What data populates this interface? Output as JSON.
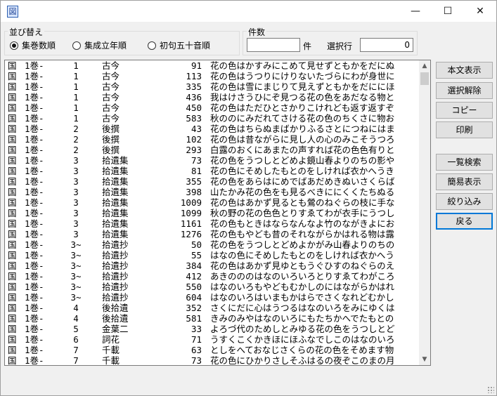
{
  "window": {
    "app_icon_glyph": "図",
    "controls": {
      "minimize": "—",
      "maximize": "☐",
      "close": "✕"
    }
  },
  "sort": {
    "label": "並び替え",
    "options": [
      {
        "label": "集巻数順",
        "selected": true
      },
      {
        "label": "集成立年順",
        "selected": false
      },
      {
        "label": "初句五十音順",
        "selected": false
      }
    ]
  },
  "count": {
    "label": "件数",
    "count_value": "",
    "count_unit": "件",
    "selected_label": "選択行",
    "selected_value": "0"
  },
  "list": {
    "rows": [
      {
        "kuni": "国",
        "kan": "1巻-",
        "vol": "1",
        "anthology": "古今",
        "num": "91",
        "text": "花の色はかすみにこめて見せずともかをだにぬ"
      },
      {
        "kuni": "国",
        "kan": "1巻-",
        "vol": "1",
        "anthology": "古今",
        "num": "113",
        "text": "花の色はうつりにけりないたづらにわが身世に"
      },
      {
        "kuni": "国",
        "kan": "1巻-",
        "vol": "1",
        "anthology": "古今",
        "num": "335",
        "text": "花の色は雪にまじりて見えずともかをだににほ"
      },
      {
        "kuni": "国",
        "kan": "1巻-",
        "vol": "1",
        "anthology": "古今",
        "num": "436",
        "text": "我はけさうひにぞ見つる花の色をあだなる物と"
      },
      {
        "kuni": "国",
        "kan": "1巻-",
        "vol": "1",
        "anthology": "古今",
        "num": "450",
        "text": "花の色はただひとさかりこけれども返す返すぞ"
      },
      {
        "kuni": "国",
        "kan": "1巻-",
        "vol": "1",
        "anthology": "古今",
        "num": "583",
        "text": "秋ののにみだれてさける花の色のちくさに物お"
      },
      {
        "kuni": "国",
        "kan": "1巻-",
        "vol": "2",
        "anthology": "後撰",
        "num": "43",
        "text": "花の色はちらぬまばかりふるさとにつねにはま"
      },
      {
        "kuni": "国",
        "kan": "1巻-",
        "vol": "2",
        "anthology": "後撰",
        "num": "102",
        "text": "花の色は昔ながらに見し人の心のみこそうつろ"
      },
      {
        "kuni": "国",
        "kan": "1巻-",
        "vol": "2",
        "anthology": "後撰",
        "num": "293",
        "text": "白露のおくにあまたの声すれば花の色色有りと"
      },
      {
        "kuni": "国",
        "kan": "1巻-",
        "vol": "3",
        "anthology": "拾遺集",
        "num": "73",
        "text": "花の色をうつしとどめよ鏡山春よりのちの影や"
      },
      {
        "kuni": "国",
        "kan": "1巻-",
        "vol": "3",
        "anthology": "拾遺集",
        "num": "81",
        "text": "花の色にそめしたもとのをしければ衣かへうき"
      },
      {
        "kuni": "国",
        "kan": "1巻-",
        "vol": "3",
        "anthology": "拾遺集",
        "num": "355",
        "text": "花の色をあらはにめでばあだめきぬいさくらば"
      },
      {
        "kuni": "国",
        "kan": "1巻-",
        "vol": "3",
        "anthology": "拾遺集",
        "num": "398",
        "text": "山たかみ花の色をも見るべきににくくたちぬる"
      },
      {
        "kuni": "国",
        "kan": "1巻-",
        "vol": "3",
        "anthology": "拾遺集",
        "num": "1009",
        "text": "花の色はあかず見るとも鶯のねぐらの枝に手な"
      },
      {
        "kuni": "国",
        "kan": "1巻-",
        "vol": "3",
        "anthology": "拾遺集",
        "num": "1099",
        "text": "秋の野の花の色色とりすゑてわが衣手にうつし"
      },
      {
        "kuni": "国",
        "kan": "1巻-",
        "vol": "3",
        "anthology": "拾遺集",
        "num": "1161",
        "text": "花の色もときはならなんなよ竹のながきよにお"
      },
      {
        "kuni": "国",
        "kan": "1巻-",
        "vol": "3",
        "anthology": "拾遺集",
        "num": "1276",
        "text": "花の色もやども昔のそれながらかはれる物は露"
      },
      {
        "kuni": "国",
        "kan": "1巻-",
        "vol": "3~",
        "anthology": "拾遺抄",
        "num": "50",
        "text": "花の色をうつしとどめよかがみ山春よりのちの"
      },
      {
        "kuni": "国",
        "kan": "1巻-",
        "vol": "3~",
        "anthology": "拾遺抄",
        "num": "55",
        "text": "はなの色にそめしたもとのをしければ衣かへう"
      },
      {
        "kuni": "国",
        "kan": "1巻-",
        "vol": "3~",
        "anthology": "拾遺抄",
        "num": "384",
        "text": "花の色はあかず見ゆともうぐひすのねぐらのえ"
      },
      {
        "kuni": "国",
        "kan": "1巻-",
        "vol": "3~",
        "anthology": "拾遺抄",
        "num": "412",
        "text": "あきのののはなのいろいろとりすゑてわがころ"
      },
      {
        "kuni": "国",
        "kan": "1巻-",
        "vol": "3~",
        "anthology": "拾遺抄",
        "num": "550",
        "text": "はなのいろもやどもむかしのにはながらかはれ"
      },
      {
        "kuni": "国",
        "kan": "1巻-",
        "vol": "3~",
        "anthology": "拾遺抄",
        "num": "604",
        "text": "はなのいろはいまもかはらでさくなれどむかし"
      },
      {
        "kuni": "国",
        "kan": "1巻-",
        "vol": "4",
        "anthology": "後拾遺",
        "num": "352",
        "text": "さくにだに心はうつるはなのいろをみにゆくは"
      },
      {
        "kuni": "国",
        "kan": "1巻-",
        "vol": "4",
        "anthology": "後拾遺",
        "num": "581",
        "text": "きみのみやはなのいろにもたちかへでたもとの"
      },
      {
        "kuni": "国",
        "kan": "1巻-",
        "vol": "5",
        "anthology": "金葉二",
        "num": "33",
        "text": "よろづ代のためしとみゆる花の色をうつしとど"
      },
      {
        "kuni": "国",
        "kan": "1巻-",
        "vol": "6",
        "anthology": "詞花",
        "num": "71",
        "text": "うすくこくかきほにほふなでしこのはなのいろ"
      },
      {
        "kuni": "国",
        "kan": "1巻-",
        "vol": "7",
        "anthology": "千載",
        "num": "63",
        "text": "としをへておなじさくらの花の色をそめます物"
      },
      {
        "kuni": "国",
        "kan": "1巻-",
        "vol": "7",
        "anthology": "千載",
        "num": "73",
        "text": "花の色にひかりさしそふはるの夜ぞこのまの月"
      }
    ]
  },
  "buttons": {
    "honbun": "本文表示",
    "kaijo": "選択解除",
    "copy": "コピー",
    "print": "印刷",
    "ichiran": "一覧検索",
    "kan_i": "簡易表示",
    "shibori": "絞り込み",
    "back": "戻る"
  },
  "scroll": {
    "up": "▲",
    "down": "▼"
  }
}
